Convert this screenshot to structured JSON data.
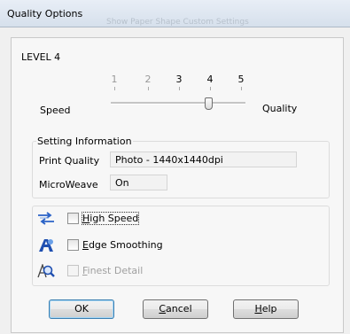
{
  "window": {
    "title": "Quality Options"
  },
  "background_toolbar_text": "Show Paper Shape        Custom Settings",
  "quality_slider": {
    "level_label": "LEVEL 4",
    "ticks": [
      "1",
      "2",
      "3",
      "4",
      "5"
    ],
    "current_level": 4,
    "min_label": "Speed",
    "max_label": "Quality"
  },
  "setting_info": {
    "group_title": "Setting Information",
    "print_quality_label": "Print Quality",
    "print_quality_value": "Photo - 1440x1440dpi",
    "microweave_label": "MicroWeave",
    "microweave_value": "On"
  },
  "options": {
    "high_speed": {
      "label_pre": "",
      "label_key": "H",
      "label_post": "igh Speed",
      "checked": false,
      "enabled": true
    },
    "edge_smoothing": {
      "label_pre": "",
      "label_key": "E",
      "label_post": "dge Smoothing",
      "checked": false,
      "enabled": true
    },
    "finest_detail": {
      "label_pre": "",
      "label_key": "F",
      "label_post": "inest Detail",
      "checked": false,
      "enabled": false
    }
  },
  "buttons": {
    "ok": {
      "label_pre": "OK",
      "label_key": "",
      "label_post": ""
    },
    "cancel": {
      "label_pre": "",
      "label_key": "C",
      "label_post": "ancel"
    },
    "help": {
      "label_pre": "",
      "label_key": "H",
      "label_post": "elp"
    }
  },
  "colors": {
    "accent_blue": "#2b63c7",
    "default_button_border": "#3c7fb1"
  }
}
